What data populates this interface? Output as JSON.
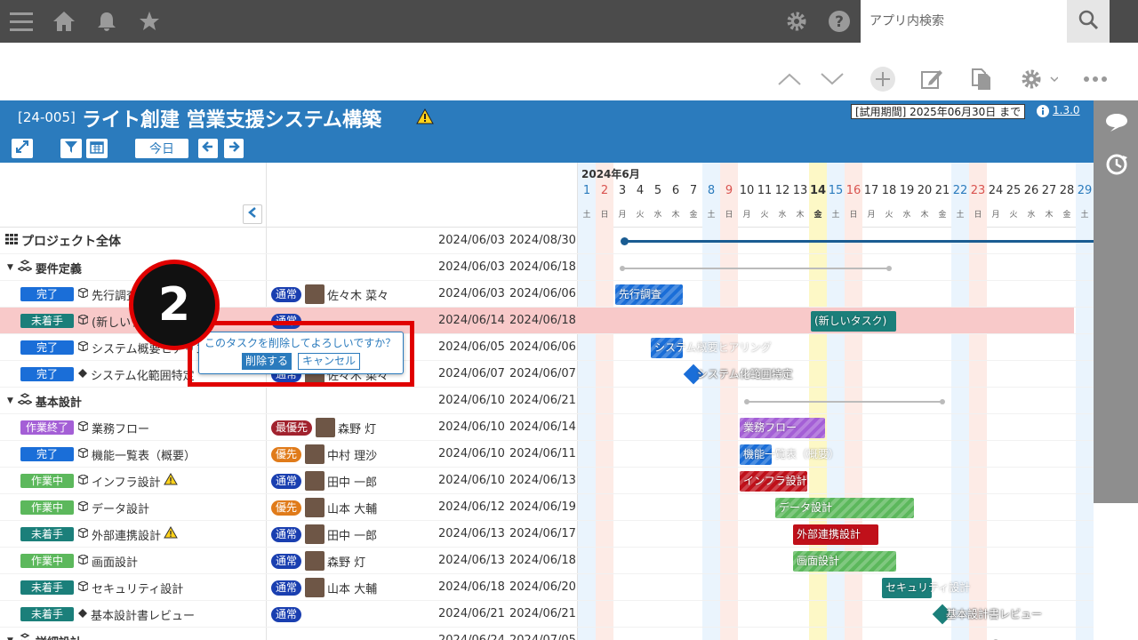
{
  "topbar": {
    "search_placeholder": "アプリ内検索",
    "icons": [
      "menu-icon",
      "home-icon",
      "bell-icon",
      "star-icon",
      "gear-icon",
      "help-icon",
      "search-icon"
    ]
  },
  "header": {
    "code": "[24-005]",
    "title": "ライト創建 営業支援システム構築",
    "trial": "[試用期間] 2025年06月30日 まで",
    "version": "1.3.0",
    "today_label": "今日"
  },
  "timeline": {
    "month": "2024年6月",
    "days": [
      "1",
      "2",
      "3",
      "4",
      "5",
      "6",
      "7",
      "8",
      "9",
      "10",
      "11",
      "12",
      "13",
      "14",
      "15",
      "16",
      "17",
      "18",
      "19",
      "20",
      "21",
      "22",
      "23",
      "24",
      "25",
      "26",
      "27",
      "28",
      "29"
    ],
    "weekdays": [
      "土",
      "日",
      "月",
      "火",
      "水",
      "木",
      "金",
      "土",
      "日",
      "月",
      "火",
      "水",
      "木",
      "金",
      "土",
      "日",
      "月",
      "火",
      "水",
      "木",
      "金",
      "土",
      "日",
      "月",
      "火",
      "水",
      "木",
      "金",
      "土"
    ]
  },
  "rows": [
    {
      "type": "project",
      "name": "プロジェクト全体",
      "start": "2024/06/03",
      "end": "2024/08/30"
    },
    {
      "type": "group",
      "name": "要件定義",
      "start": "2024/06/03",
      "end": "2024/06/18"
    },
    {
      "type": "task",
      "status": "完了",
      "status_color": "#1a6ed8",
      "name": "先行調査",
      "prio": "通常",
      "prio_color": "#1a3fb0",
      "assignee": "佐々木 菜々",
      "start": "2024/06/03",
      "end": "2024/06/06",
      "bar": "先行調査"
    },
    {
      "type": "task",
      "status": "未着手",
      "status_color": "#1b7f7a",
      "name": "(新しいタスク)",
      "prio": "通常",
      "prio_color": "#1a3fb0",
      "assignee": "",
      "start": "2024/06/14",
      "end": "2024/06/18",
      "bar": "(新しいタスク)",
      "highlight": true
    },
    {
      "type": "task",
      "status": "完了",
      "status_color": "#1a6ed8",
      "name": "システム概要ヒアリング",
      "prio": "通常",
      "prio_color": "#1a3fb0",
      "assignee": "",
      "start": "2024/06/05",
      "end": "2024/06/06",
      "bar": "システム概要ヒアリング"
    },
    {
      "type": "milestone",
      "status": "完了",
      "status_color": "#1a6ed8",
      "name": "システム化範囲特定",
      "prio": "通常",
      "prio_color": "#1a3fb0",
      "assignee": "佐々木 菜々",
      "start": "2024/06/07",
      "end": "2024/06/07",
      "bar": "システム化範囲特定"
    },
    {
      "type": "group",
      "name": "基本設計",
      "start": "2024/06/10",
      "end": "2024/06/21"
    },
    {
      "type": "task",
      "status": "作業終了",
      "status_color": "#a45fd6",
      "name": "業務フロー",
      "prio": "最優先",
      "prio_color": "#a1222e",
      "assignee": "森野 灯",
      "start": "2024/06/10",
      "end": "2024/06/14",
      "bar": "業務フロー"
    },
    {
      "type": "task",
      "status": "完了",
      "status_color": "#1a6ed8",
      "name": "機能一覧表（概要）",
      "prio": "優先",
      "prio_color": "#e07b1a",
      "assignee": "中村 理沙",
      "start": "2024/06/10",
      "end": "2024/06/11",
      "bar": "機能一覧表（概要）"
    },
    {
      "type": "task",
      "status": "作業中",
      "status_color": "#5cb85c",
      "name": "インフラ設計",
      "warn": true,
      "prio": "通常",
      "prio_color": "#1a3fb0",
      "assignee": "田中 一郎",
      "start": "2024/06/10",
      "end": "2024/06/13",
      "bar": "インフラ設計"
    },
    {
      "type": "task",
      "status": "作業中",
      "status_color": "#5cb85c",
      "name": "データ設計",
      "prio": "優先",
      "prio_color": "#e07b1a",
      "assignee": "山本 大輔",
      "start": "2024/06/12",
      "end": "2024/06/19",
      "bar": "データ設計"
    },
    {
      "type": "task",
      "status": "未着手",
      "status_color": "#1b7f7a",
      "name": "外部連携設計",
      "warn": true,
      "prio": "通常",
      "prio_color": "#1a3fb0",
      "assignee": "田中 一郎",
      "start": "2024/06/13",
      "end": "2024/06/17",
      "bar": "外部連携設計"
    },
    {
      "type": "task",
      "status": "作業中",
      "status_color": "#5cb85c",
      "name": "画面設計",
      "prio": "通常",
      "prio_color": "#1a3fb0",
      "assignee": "森野 灯",
      "start": "2024/06/13",
      "end": "2024/06/18",
      "bar": "画面設計"
    },
    {
      "type": "task",
      "status": "未着手",
      "status_color": "#1b7f7a",
      "name": "セキュリティ設計",
      "prio": "通常",
      "prio_color": "#1a3fb0",
      "assignee": "山本 大輔",
      "start": "2024/06/18",
      "end": "2024/06/20",
      "bar": "セキュリティ設計"
    },
    {
      "type": "milestone",
      "status": "未着手",
      "status_color": "#1b7f7a",
      "name": "基本設計書レビュー",
      "prio": "通常",
      "prio_color": "#1a3fb0",
      "assignee": "",
      "start": "2024/06/21",
      "end": "2024/06/21",
      "bar": "基本設計書レビュー"
    },
    {
      "type": "group",
      "name": "詳細設計",
      "start": "2024/06/24",
      "end": "2024/07/05"
    }
  ],
  "popup": {
    "message": "このタスクを削除してよろしいですか？",
    "delete_label": "削除する",
    "cancel_label": "キャンセル"
  },
  "step_badge": "2"
}
